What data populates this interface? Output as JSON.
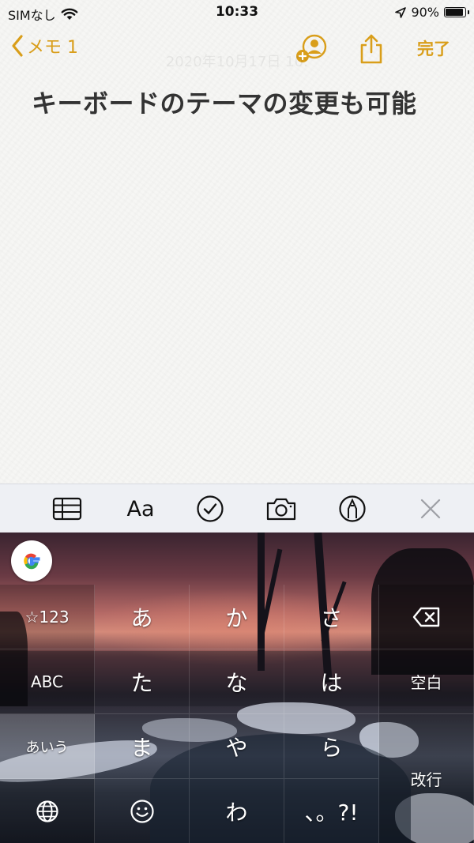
{
  "status_bar": {
    "carrier": "SIMなし",
    "time": "10:33",
    "battery_percent": "90%",
    "battery_level": 0.9
  },
  "nav": {
    "back_label": "メモ 1",
    "done_label": "完了",
    "accent_color": "#d99e1a"
  },
  "note": {
    "date_faint": "2020年10月17日 10:",
    "title": "キーボードのテーマの変更も可能"
  },
  "toolbar": {
    "format_label": "Aa",
    "icons": [
      "table-icon",
      "format-icon",
      "checklist-icon",
      "camera-icon",
      "markup-icon",
      "close-icon"
    ]
  },
  "keyboard": {
    "rows": [
      [
        "☆123",
        "あ",
        "か",
        "さ",
        "⌫"
      ],
      [
        "ABC",
        "た",
        "な",
        "は",
        "空白"
      ],
      [
        "あいう",
        "ま",
        "や",
        "ら",
        "改行"
      ],
      [
        "🌐",
        "☺",
        "わ",
        "、。?!",
        ""
      ]
    ],
    "google_logo": "G"
  }
}
